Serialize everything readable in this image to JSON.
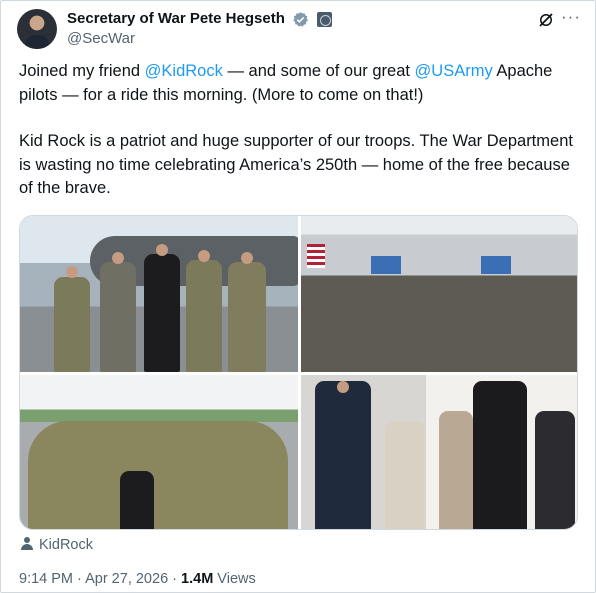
{
  "post": {
    "display_name": "Secretary of War Pete Hegseth",
    "handle": "@SecWar",
    "text_p1_a": "Joined my friend ",
    "mention1": "@KidRock",
    "text_p1_b": " — and some of our great ",
    "mention2": "@USArmy",
    "text_p1_c": " Apache pilots — for a ride this morning. (More to come on that!)",
    "text_p2": "Kid Rock is a patriot and huge supporter of our troops. The War Department is wasting no time celebrating America’s 250th — home of the free because of the brave.",
    "attribution": "KidRock",
    "time": "9:14 PM",
    "separator1": " · ",
    "date": "Apr 27, 2026",
    "separator2": " · ",
    "views_count": "1.4M",
    "views_label": " Views"
  },
  "icons": {
    "verified": "verified-badge-icon",
    "government": "government-seal-icon",
    "grok": "grok-icon",
    "more": "more-options-icon",
    "person": "person-icon"
  },
  "colors": {
    "link": "#1d9bf0",
    "verified_badge": "#829aab",
    "secondary_text": "#536471"
  }
}
